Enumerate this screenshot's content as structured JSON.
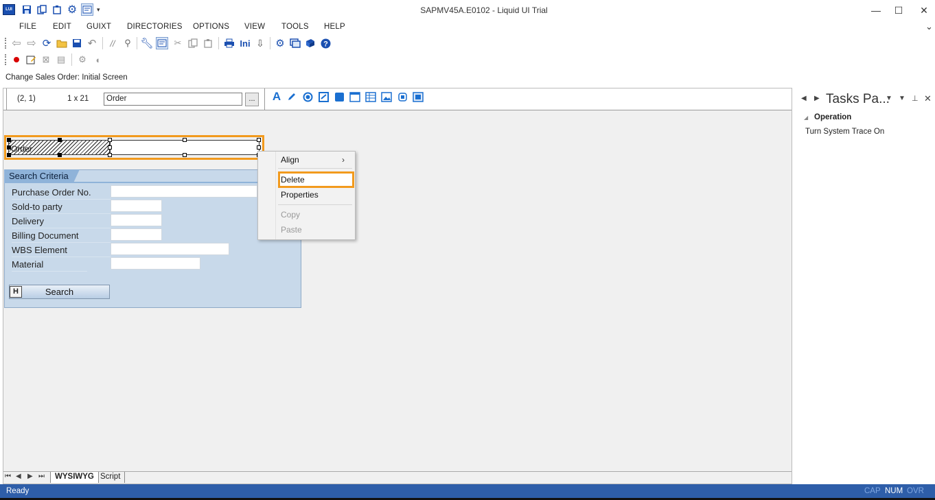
{
  "window": {
    "title": "SAPMV45A.E0102 - Liquid UI Trial",
    "minimize": "—",
    "maximize": "☐",
    "close": "✕",
    "ribbon_toggle": "⌄"
  },
  "menu": [
    "FILE",
    "EDIT",
    "GUIXT",
    "DIRECTORIES",
    "OPTIONS",
    "VIEW",
    "TOOLS",
    "HELP"
  ],
  "screen_title": "Change Sales Order: Initial Screen",
  "property_bar": {
    "position": "(2, 1)",
    "size": "1 x 21",
    "name_value": "Order",
    "browse_label": "..."
  },
  "selected_element": {
    "label": "Order"
  },
  "groupbox": {
    "title": "Search Criteria",
    "fields": [
      "Purchase Order No.",
      "Sold-to party",
      "Delivery",
      "Billing Document",
      "WBS Element",
      "Material"
    ],
    "search_button": "Search",
    "search_icon_glyph": "H"
  },
  "context_menu": {
    "items": [
      {
        "label": "Align",
        "submenu_arrow": "›",
        "enabled": true
      },
      {
        "label": "Delete",
        "enabled": true,
        "highlighted": true
      },
      {
        "label": "Properties",
        "enabled": true
      },
      {
        "label": "Copy",
        "enabled": false
      },
      {
        "label": "Paste",
        "enabled": false
      }
    ]
  },
  "bottom_tabs": {
    "nav": [
      "⏮",
      "◀",
      "▶",
      "⏭"
    ],
    "tabs": [
      {
        "label": "WYSIWYG",
        "active": true
      },
      {
        "label": "Script",
        "active": false
      }
    ]
  },
  "task_pane": {
    "title": "Tasks Pa...",
    "section": "Operation",
    "link": "Turn System Trace On"
  },
  "status_bar": {
    "text": "Ready",
    "indicators": [
      {
        "label": "CAP",
        "active": false
      },
      {
        "label": "NUM",
        "active": true
      },
      {
        "label": "OVR",
        "active": false
      }
    ]
  },
  "icons": {
    "app": "liquid-ui-logo-icon",
    "toolbar": [
      "back-arrow-icon",
      "forward-arrow-icon",
      "refresh-icon",
      "open-folder-icon",
      "save-icon",
      "undo-icon",
      "comment-icon",
      "find-icon",
      "wrench-icon",
      "form-icon",
      "cut-icon",
      "copy-icon",
      "paste-icon",
      "print-icon",
      "ini-icon",
      "download-icon",
      "gear-icon",
      "screen-icon",
      "book-icon",
      "help-icon"
    ],
    "tools": [
      "text-tool-icon",
      "pen-tool-icon",
      "radio-tool-icon",
      "checkbox-tool-icon",
      "box-tool-icon",
      "window-tool-icon",
      "table-tool-icon",
      "image-tool-icon",
      "pushbutton-tool-icon",
      "layout-tool-icon"
    ]
  },
  "colors": {
    "accent_highlight": "#f29a1d",
    "status_bar": "#2e5ea9",
    "groupbox": "#c8d9ea",
    "icon_blue": "#1a4fb0"
  }
}
